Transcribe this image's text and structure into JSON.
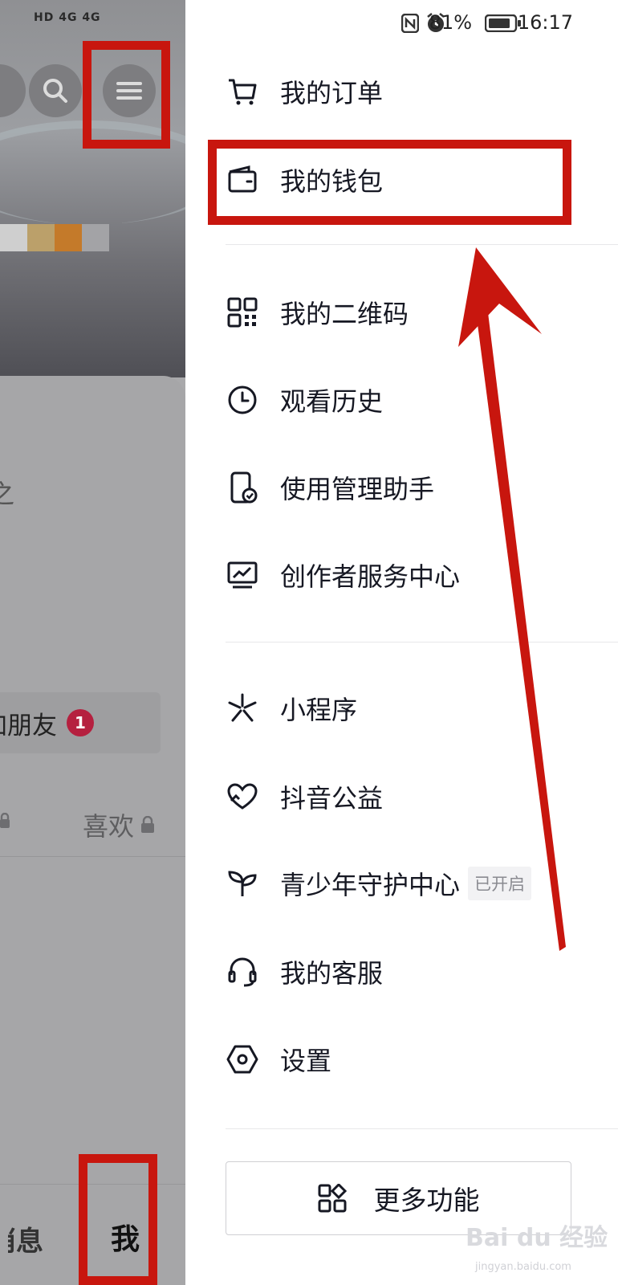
{
  "status_bar": {
    "left_indicators": "HD 4G 4G",
    "battery_percent": "81%",
    "time": "16:17"
  },
  "profile_background": {
    "edit_hint_fragment": "之",
    "add_friends_fragment": "加朋友",
    "add_friends_badge": "1",
    "likes_tab": "喜欢",
    "nav_messages_fragment": "消息",
    "nav_me": "我"
  },
  "drawer": {
    "menu_group_1": [
      {
        "label": "我的订单",
        "icon": "cart-icon"
      },
      {
        "label": "我的钱包",
        "icon": "wallet-icon"
      }
    ],
    "menu_group_2": [
      {
        "label": "我的二维码",
        "icon": "qr-code-icon"
      },
      {
        "label": "观看历史",
        "icon": "clock-icon"
      },
      {
        "label": "使用管理助手",
        "icon": "phone-check-icon"
      },
      {
        "label": "创作者服务中心",
        "icon": "chart-monitor-icon"
      }
    ],
    "menu_group_3": [
      {
        "label": "小程序",
        "icon": "mini-program-icon"
      },
      {
        "label": "抖音公益",
        "icon": "heart-hand-icon"
      },
      {
        "label": "青少年守护中心",
        "icon": "sprout-icon",
        "tag": "已开启"
      },
      {
        "label": "我的客服",
        "icon": "headset-icon"
      },
      {
        "label": "设置",
        "icon": "hexagon-settings-icon"
      }
    ],
    "more_button": "更多功能"
  },
  "annotation_color": "#c8160e",
  "watermark": {
    "text": "Bai du 经验",
    "sub": "jingyan.baidu.com"
  }
}
